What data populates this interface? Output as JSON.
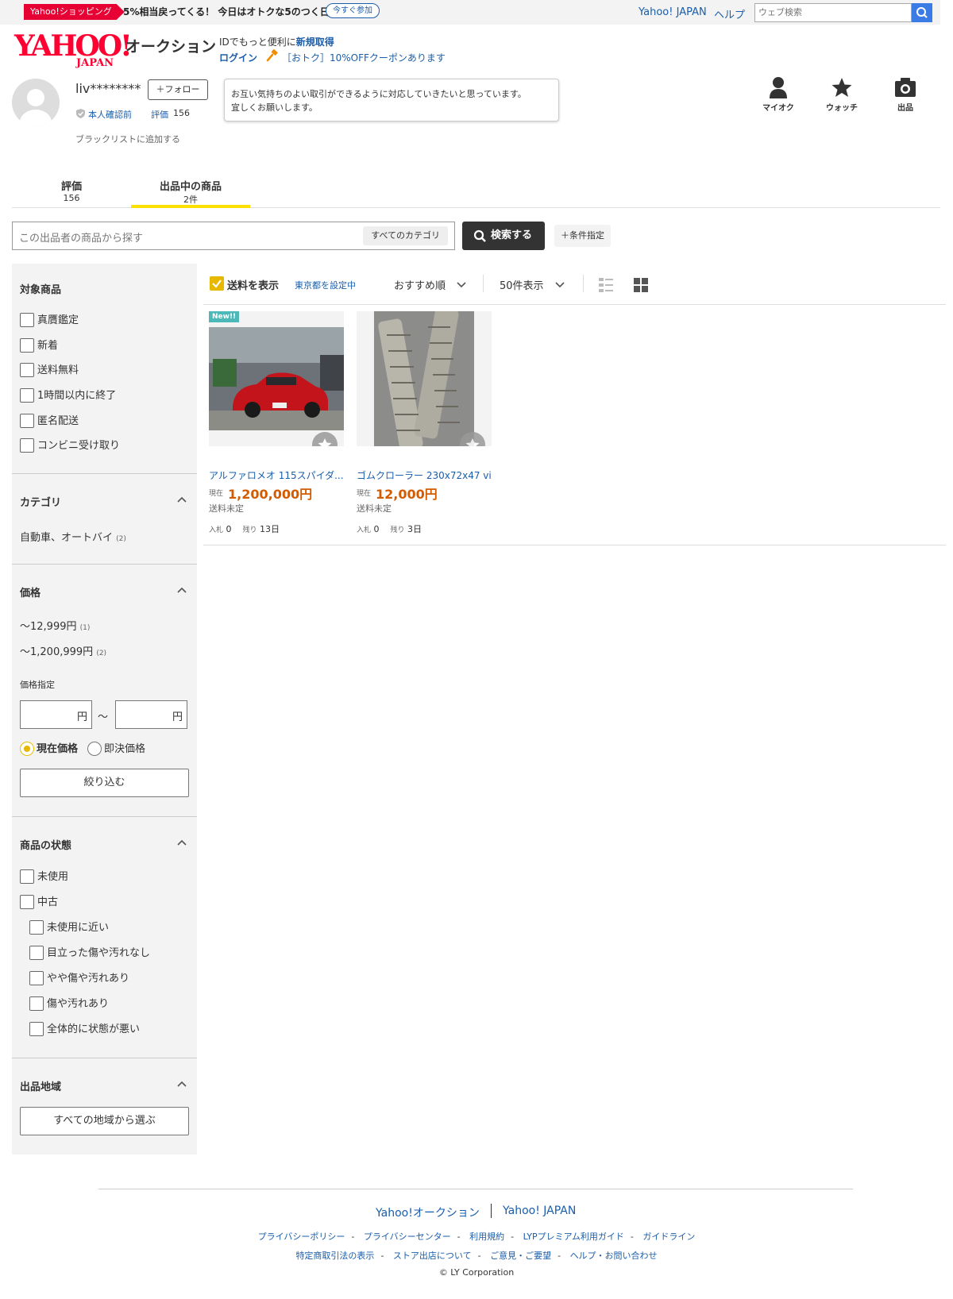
{
  "topbar": {
    "promo_badge": "Yahoo!ショッピング",
    "promo_text": "5%相当戻ってくる！ 今日はオトクな5のつく日",
    "promo_join": "今すぐ参加",
    "yahoo_japan": "Yahoo! JAPAN",
    "help": "ヘルプ",
    "web_search_placeholder": "ウェブ検索"
  },
  "header": {
    "logo_main": "YAHOO!",
    "logo_sub": "JAPAN",
    "logo_auction": "オークション",
    "line1_prefix": "IDでもっと便利に",
    "line1_link": "新規取得",
    "login": "ログイン",
    "coupon": "［おトク］10%OFFクーポンあります"
  },
  "profile": {
    "seller_name": "liv********",
    "follow": "＋フォロー",
    "verify": "本人確認前",
    "rating_label": "評価",
    "rating_value": "156",
    "blacklist": "ブラックリストに追加する",
    "message_line1": "お互い気持ちのよい取引ができるように対応していきたいと思っています。",
    "message_line2": "宜しくお願いします。"
  },
  "nav": {
    "myauc": "マイオク",
    "watch": "ウォッチ",
    "sell": "出品"
  },
  "tabs": [
    {
      "label": "評価",
      "sub": "156"
    },
    {
      "label": "出品中の商品",
      "sub": "2件"
    }
  ],
  "search": {
    "placeholder": "この出品者の商品から探す",
    "category": "すべてのカテゴリ",
    "button": "検索する",
    "conditions": "＋条件指定"
  },
  "sidebar": {
    "target_title": "対象商品",
    "target_items": [
      "真贋鑑定",
      "新着",
      "送料無料",
      "1時間以内に終了",
      "匿名配送",
      "コンビニ受け取り"
    ],
    "category_title": "カテゴリ",
    "category_item": "自動車、オートバイ",
    "category_count": "(2)",
    "price_title": "価格",
    "price_ranges": [
      {
        "label": "〜12,999円",
        "count": "(1)"
      },
      {
        "label": "〜1,200,999円",
        "count": "(2)"
      }
    ],
    "price_specify": "価格指定",
    "yen": "円",
    "tilde": "〜",
    "radio_current": "現在価格",
    "radio_buynow": "即決価格",
    "filter_button": "絞り込む",
    "condition_title": "商品の状態",
    "condition_items": [
      "未使用",
      "中古"
    ],
    "condition_sub_items": [
      "未使用に近い",
      "目立った傷や汚れなし",
      "やや傷や汚れあり",
      "傷や汚れあり",
      "全体的に状態が悪い"
    ],
    "region_title": "出品地域",
    "region_button": "すべての地域から選ぶ"
  },
  "toolbar": {
    "ship_label": "送料を表示",
    "ship_location": "東京都を設定中",
    "sort": "おすすめ順",
    "per_page": "50件表示"
  },
  "items": [
    {
      "badge": "New!!",
      "title": "アルファロメオ 115スパイダ...",
      "current_label": "現在",
      "price": "1,200,000円",
      "shipping": "送料未定",
      "bids_label": "入札",
      "bids": "0",
      "remaining_label": "残り",
      "remaining": "13日"
    },
    {
      "title": "ゴムクローラー 230x72x47 vi...",
      "current_label": "現在",
      "price": "12,000円",
      "shipping": "送料未定",
      "bids_label": "入札",
      "bids": "0",
      "remaining_label": "残り",
      "remaining": "3日"
    }
  ],
  "footer": {
    "auction": "Yahoo!オークション",
    "yahoo_japan": "Yahoo! JAPAN",
    "links_row1": [
      "プライバシーポリシー",
      "プライバシーセンター",
      "利用規約",
      "LYPプレミアム利用ガイド",
      "ガイドライン"
    ],
    "links_row2": [
      "特定商取引法の表示",
      "ストア出店について",
      "ご意見・ご要望",
      "ヘルプ・お問い合わせ"
    ],
    "copyright": "© LY Corporation"
  },
  "colors": {
    "brand_red": "#ff0033",
    "link_blue": "#1a5eab",
    "accent_yellow": "#fce100",
    "price_orange": "#d35b00"
  }
}
